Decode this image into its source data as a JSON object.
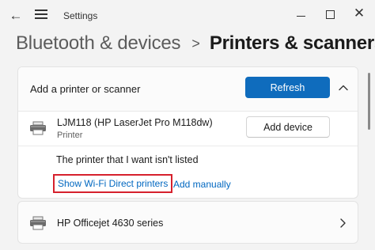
{
  "titlebar": {
    "title": "Settings",
    "back_icon": "back-arrow-icon",
    "menu_icon": "hamburger-menu-icon",
    "minimize_icon": "minimize-icon",
    "maximize_icon": "maximize-icon",
    "close_icon": "close-icon"
  },
  "breadcrumb": {
    "parent": "Bluetooth & devices",
    "separator": ">",
    "current": "Printers & scanners"
  },
  "add_section": {
    "label": "Add a printer or scanner",
    "refresh_label": "Refresh",
    "expanded": true
  },
  "found_printer": {
    "name": "LJM118 (HP LaserJet Pro M118dw)",
    "type": "Printer",
    "add_device_label": "Add device"
  },
  "not_listed": {
    "text": "The printer that I want isn't listed",
    "wifi_direct_link": "Show Wi-Fi Direct printers",
    "add_manually_link": "Add manually",
    "highlight_color": "#d6212d"
  },
  "installed_printers": [
    {
      "name": "HP Officejet 4630 series"
    }
  ],
  "colors": {
    "accent": "#0f6cbd",
    "link": "#0067c0",
    "background": "#f3f3f3"
  }
}
